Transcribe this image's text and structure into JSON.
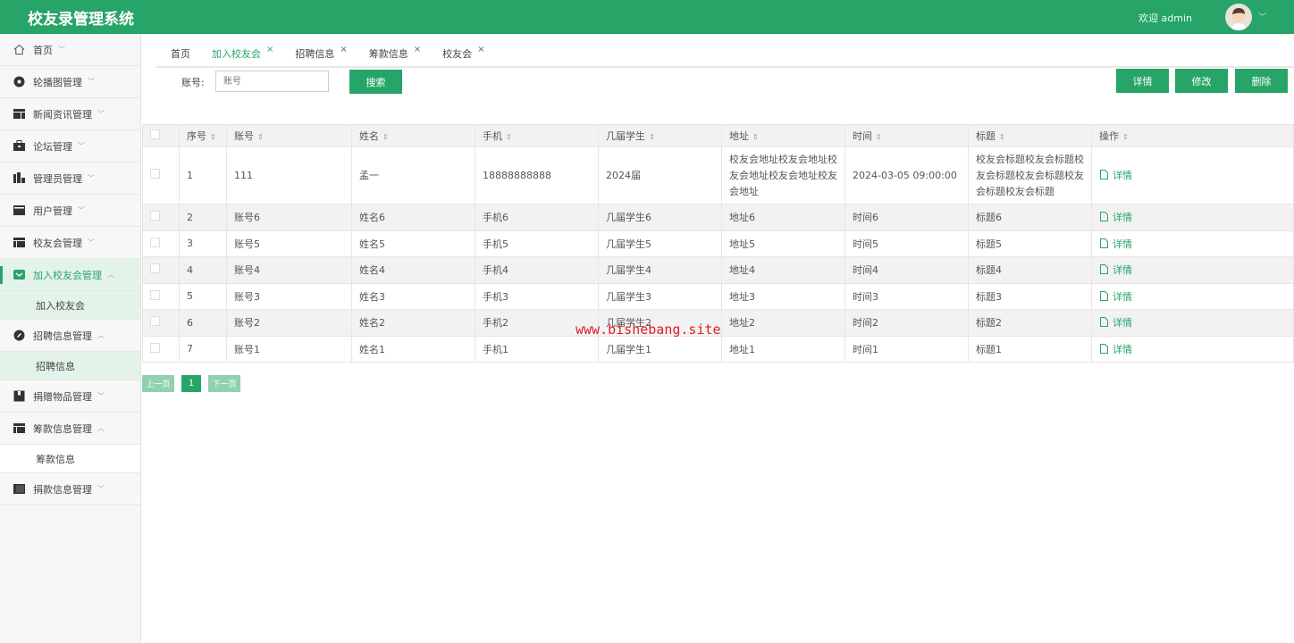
{
  "header": {
    "title": "校友录管理系统",
    "welcome": "欢迎 admin"
  },
  "sidebar": {
    "items": [
      {
        "label": "首页",
        "icon": "home-icon",
        "arrow": "﹀"
      },
      {
        "label": "轮播图管理",
        "icon": "carousel-icon",
        "arrow": "﹀"
      },
      {
        "label": "新闻资讯管理",
        "icon": "news-icon",
        "arrow": "﹀"
      },
      {
        "label": "论坛管理",
        "icon": "briefcase-icon",
        "arrow": "﹀"
      },
      {
        "label": "管理员管理",
        "icon": "chart-icon",
        "arrow": "﹀"
      },
      {
        "label": "用户管理",
        "icon": "user-card-icon",
        "arrow": "﹀"
      },
      {
        "label": "校友会管理",
        "icon": "layout-icon",
        "arrow": "﹀"
      },
      {
        "label": "加入校友会管理",
        "icon": "envelope-icon",
        "arrow": "︿",
        "sub": "加入校友会"
      },
      {
        "label": "招聘信息管理",
        "icon": "compass-icon",
        "arrow": "︿",
        "sub": "招聘信息"
      },
      {
        "label": "捐赠物品管理",
        "icon": "book-icon",
        "arrow": "﹀"
      },
      {
        "label": "筹款信息管理",
        "icon": "layout-icon",
        "arrow": "︿",
        "sub": "筹款信息"
      },
      {
        "label": "捐款信息管理",
        "icon": "panel-icon",
        "arrow": "﹀"
      }
    ]
  },
  "tabs": [
    {
      "label": "首页"
    },
    {
      "label": "加入校友会"
    },
    {
      "label": "招聘信息"
    },
    {
      "label": "筹款信息"
    },
    {
      "label": "校友会"
    }
  ],
  "close_glyph": "×",
  "search": {
    "label": "账号:",
    "placeholder": "账号",
    "button": "搜索"
  },
  "actions": {
    "detail": "详情",
    "edit": "修改",
    "delete": "删除"
  },
  "table": {
    "columns": [
      "序号",
      "账号",
      "姓名",
      "手机",
      "几届学生",
      "地址",
      "时间",
      "标题",
      "操作"
    ],
    "rows": [
      [
        "1",
        "111",
        "孟一",
        "18888888888",
        "2024届",
        "校友会地址校友会地址校友会地址校友会地址校友会地址",
        "2024-03-05 09:00:00",
        "校友会标题校友会标题校友会标题校友会标题校友会标题校友会标题",
        "详情"
      ],
      [
        "2",
        "账号6",
        "姓名6",
        "手机6",
        "几届学生6",
        "地址6",
        "时间6",
        "标题6",
        "详情"
      ],
      [
        "3",
        "账号5",
        "姓名5",
        "手机5",
        "几届学生5",
        "地址5",
        "时间5",
        "标题5",
        "详情"
      ],
      [
        "4",
        "账号4",
        "姓名4",
        "手机4",
        "几届学生4",
        "地址4",
        "时间4",
        "标题4",
        "详情"
      ],
      [
        "5",
        "账号3",
        "姓名3",
        "手机3",
        "几届学生3",
        "地址3",
        "时间3",
        "标题3",
        "详情"
      ],
      [
        "6",
        "账号2",
        "姓名2",
        "手机2",
        "几届学生2",
        "地址2",
        "时间2",
        "标题2",
        "详情"
      ],
      [
        "7",
        "账号1",
        "姓名1",
        "手机1",
        "几届学生1",
        "地址1",
        "时间1",
        "标题1",
        "详情"
      ]
    ]
  },
  "pagination": {
    "prev": "上一页",
    "current": "1",
    "next": "下一页"
  },
  "watermark": "www.bishebang.site",
  "colors": {
    "accent": "#27a467"
  }
}
